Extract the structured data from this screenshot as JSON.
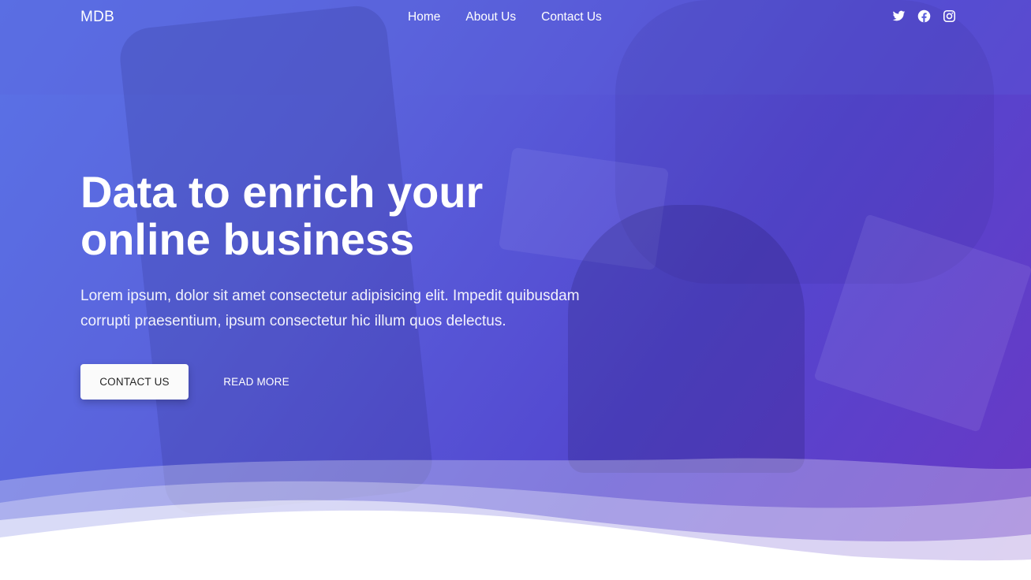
{
  "navbar": {
    "brand": "MDB",
    "links": [
      {
        "label": "Home"
      },
      {
        "label": "About Us"
      },
      {
        "label": "Contact Us"
      }
    ],
    "social": [
      "twitter-icon",
      "facebook-icon",
      "instagram-icon"
    ]
  },
  "hero": {
    "headline_line1": "Data to enrich your",
    "headline_line2": "online business",
    "lead": "Lorem ipsum, dolor sit amet consectetur adipisicing elit. Impedit quibusdam corrupti praesentium, ipsum consectetur hic illum quos delectus.",
    "primary_button": "CONTACT US",
    "secondary_button": "READ MORE"
  },
  "colors": {
    "gradient_start": "#5a72e6",
    "gradient_end": "#6a38c4",
    "button_bg": "#fbfbfb",
    "text": "#ffffff"
  }
}
